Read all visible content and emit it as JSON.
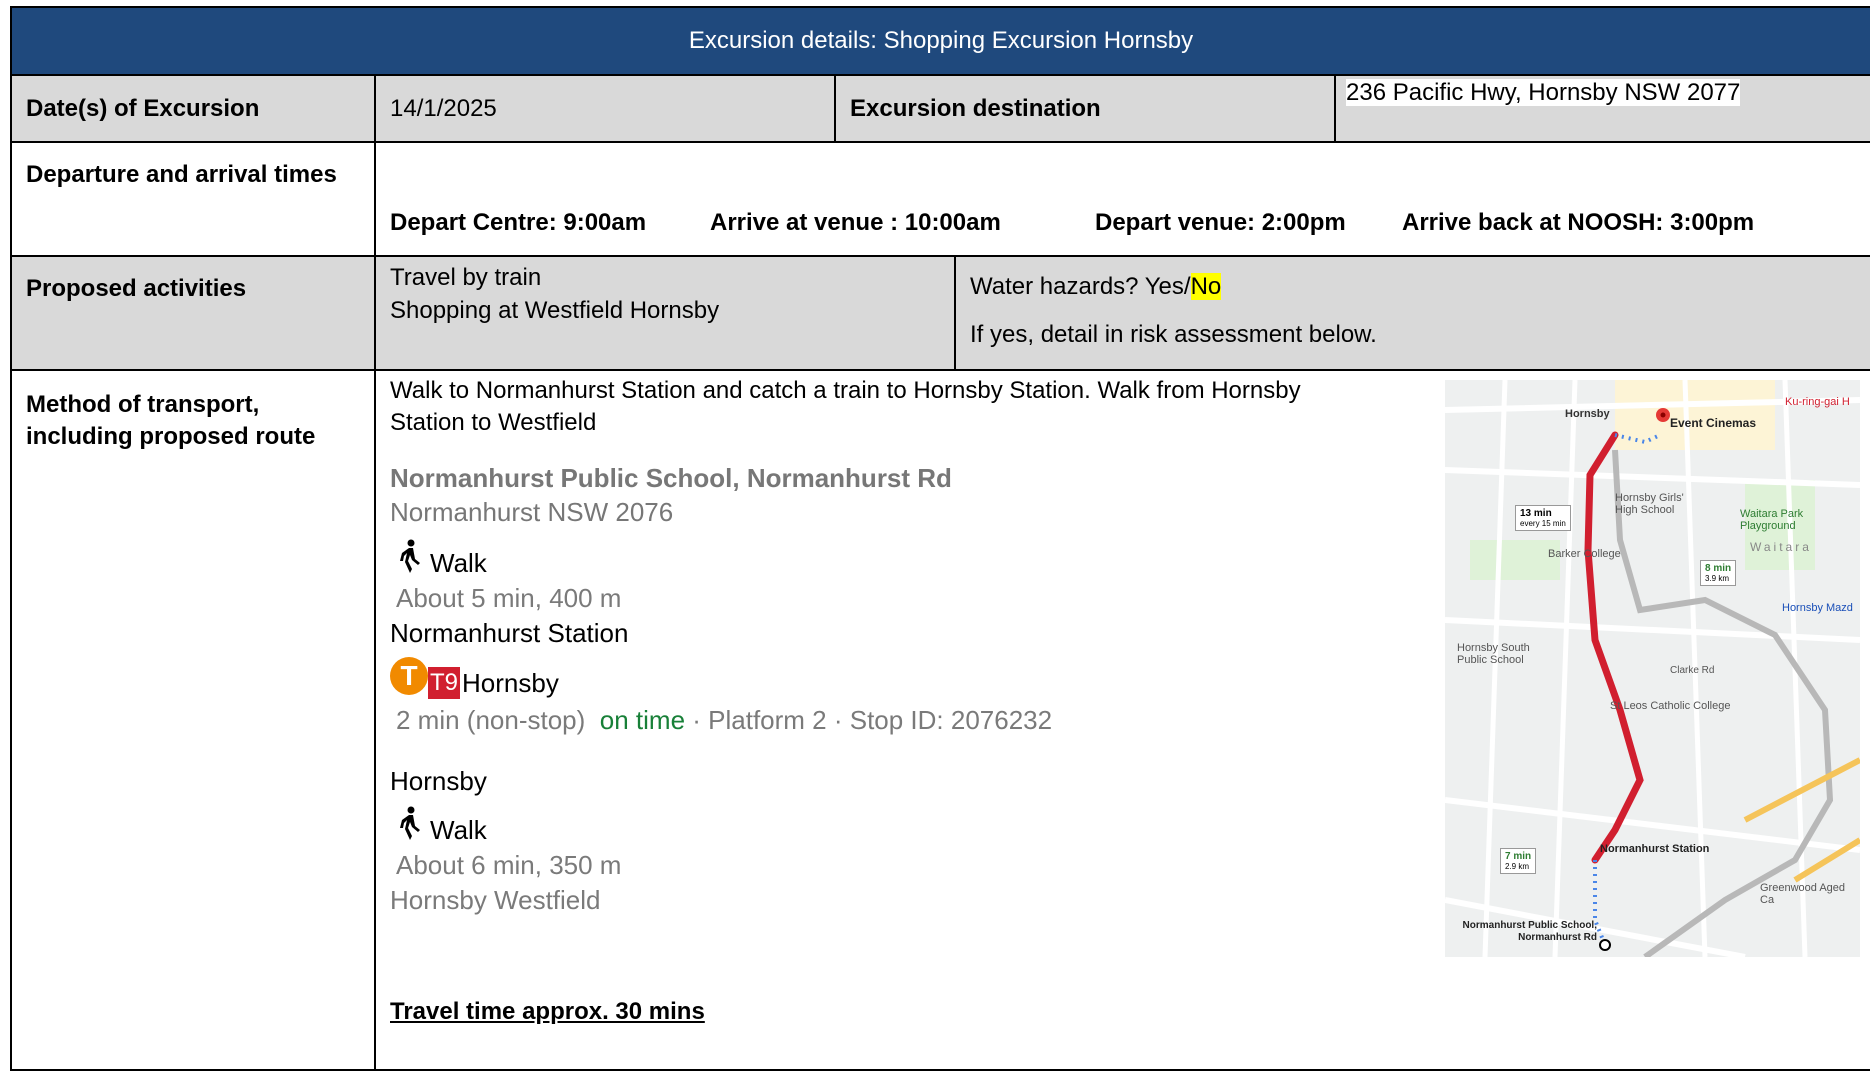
{
  "header": {
    "title": "Excursion details: Shopping Excursion Hornsby"
  },
  "row_dates": {
    "label": "Date(s) of Excursion",
    "value": "14/1/2025",
    "dest_label": "Excursion destination",
    "dest_value": "236 Pacific Hwy, Hornsby NSW 2077"
  },
  "row_times": {
    "label": "Departure and arrival times",
    "depart_centre": "Depart Centre: 9:00am",
    "arrive_venue": "Arrive at venue :   10:00am",
    "depart_venue": "Depart venue:   2:00pm",
    "arrive_back": "Arrive back at NOOSH:  3:00pm"
  },
  "row_activities": {
    "label": "Proposed activities",
    "line1": "Travel by train",
    "line2": "Shopping at Westfield Hornsby",
    "water_prefix": "Water hazards?   Yes/",
    "water_no": "No",
    "water_note": "If yes, detail in risk assessment below."
  },
  "row_transport": {
    "label": "Method of transport, including proposed route",
    "intro": "Walk to Normanhurst Station and catch a train to Hornsby Station. Walk from Hornsby Station to Westfield",
    "origin_title": "Normanhurst Public School, Normanhurst Rd",
    "origin_sub": "Normanhurst NSW 2076",
    "walk1_label": "Walk",
    "walk1_detail": "About 5 min, 400 m",
    "station1": "Normanhurst Station",
    "train_badge": "T",
    "train_line": "T9",
    "train_dest": "Hornsby",
    "train_detail_a": "2 min (non-stop)",
    "train_detail_on_time": "on time",
    "train_detail_b": " · Platform 2 · Stop ID: 2076232",
    "station2": "Hornsby",
    "walk2_label": "Walk",
    "walk2_detail": "About 6 min, 350 m",
    "destination": "Hornsby Westfield",
    "travel_time": "Travel time approx. 30 mins"
  },
  "map": {
    "labels": {
      "hornsby": "Hornsby",
      "event": "Event Cinemas",
      "ku": "Ku-ring-gai H",
      "girls": "Hornsby Girls' High School",
      "waitara_park": "Waitara Park Playground",
      "waitara": "Waitara",
      "barker": "Barker College",
      "mazda": "Hornsby Mazd",
      "south": "Hornsby South Public School",
      "clarke": "Clarke Rd",
      "stleos": "St Leos Catholic College",
      "norm_station": "Normanhurst Station",
      "greenwood": "Greenwood Aged Ca",
      "norm_school": "Normanhurst Public School, Normanhurst Rd",
      "train_time": "13 min",
      "train_freq": "every 15 min",
      "car8": "8 min",
      "car8_dist": "3.9 km",
      "car7": "7 min",
      "car7_dist": "2.9 km"
    }
  }
}
